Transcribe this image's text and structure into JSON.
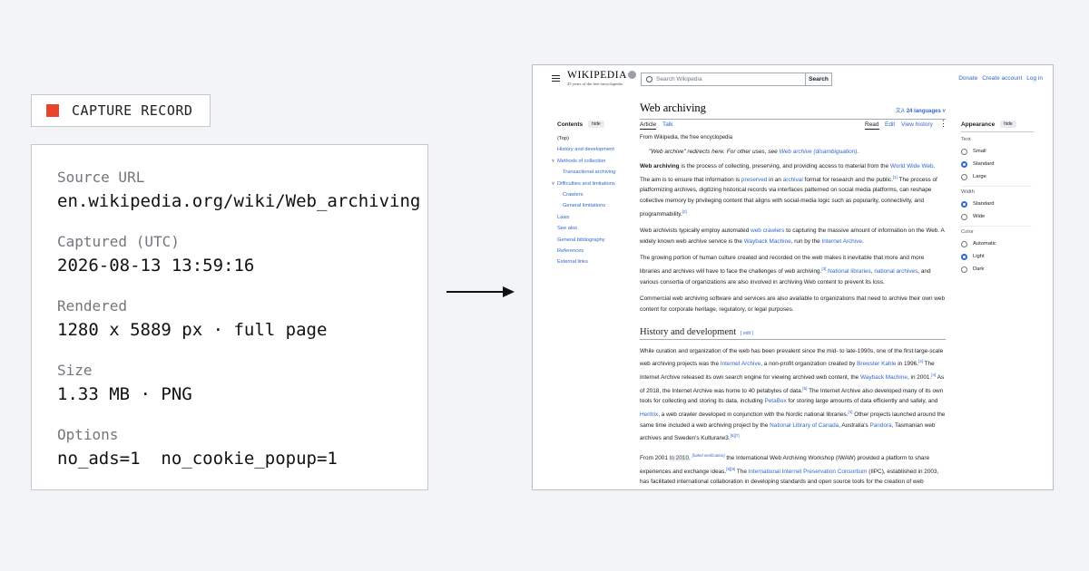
{
  "capture": {
    "badge_label": "CAPTURE RECORD",
    "badge_color": "#e8452b",
    "rows": [
      {
        "label": "Source URL",
        "value": "en.wikipedia.org/wiki/Web_archiving"
      },
      {
        "label": "Captured (UTC)",
        "value": "2026-08-13 13:59:16"
      },
      {
        "label": "Rendered",
        "value": "1280 x 5889 px · full page"
      },
      {
        "label": "Size",
        "value": "1.33 MB · PNG"
      },
      {
        "label": "Options",
        "value": "no_ads=1  no_cookie_popup=1"
      }
    ]
  },
  "wiki": {
    "logo_name": "WIKIPEDIA",
    "logo_tagline": "25 years of the free encyclopedia",
    "search_placeholder": "Search Wikipedia",
    "search_button": "Search",
    "user_links": [
      "Donate",
      "Create account",
      "Log in"
    ],
    "toc": {
      "title": "Contents",
      "hide_label": "hide",
      "items": [
        {
          "label": "(Top)",
          "level": "top",
          "chevron": ""
        },
        {
          "label": "History and development",
          "level": "l1",
          "chevron": ""
        },
        {
          "label": "Methods of collection",
          "level": "l1",
          "chevron": "˅"
        },
        {
          "label": "Transactional archiving",
          "level": "l2",
          "chevron": ""
        },
        {
          "label": "Difficulties and limitations",
          "level": "l1",
          "chevron": "˅"
        },
        {
          "label": "Crawlers",
          "level": "l2",
          "chevron": ""
        },
        {
          "label": "General limitations",
          "level": "l2",
          "chevron": ""
        },
        {
          "label": "Laws",
          "level": "l1",
          "chevron": ""
        },
        {
          "label": "See also",
          "level": "l1",
          "chevron": ""
        },
        {
          "label": "General bibliography",
          "level": "l1",
          "chevron": ""
        },
        {
          "label": "References",
          "level": "l1",
          "chevron": ""
        },
        {
          "label": "External links",
          "level": "l1",
          "chevron": ""
        }
      ]
    },
    "article": {
      "title": "Web archiving",
      "languages": "24 languages",
      "tabs": {
        "article": "Article",
        "talk": "Talk",
        "read": "Read",
        "edit": "Edit",
        "history": "View history"
      },
      "from_line": "From Wikipedia, the free encyclopedia",
      "hatnote_pre": "\"Web archive\" redirects here. For other uses, see ",
      "hatnote_link": "Web archive (disambiguation)",
      "hatnote_post": ".",
      "section_history": "History and development",
      "section_edit": "[ edit ]"
    },
    "appearance": {
      "title": "Appearance",
      "hide_label": "hide",
      "text_label": "Text",
      "text_options": [
        {
          "label": "Small",
          "selected": false
        },
        {
          "label": "Standard",
          "selected": true
        },
        {
          "label": "Large",
          "selected": false
        }
      ],
      "width_label": "Width",
      "width_options": [
        {
          "label": "Standard",
          "selected": true
        },
        {
          "label": "Wide",
          "selected": false
        }
      ],
      "color_label": "Color",
      "color_options": [
        {
          "label": "Automatic",
          "selected": false
        },
        {
          "label": "Light",
          "selected": true
        },
        {
          "label": "Dark",
          "selected": false
        }
      ]
    }
  }
}
